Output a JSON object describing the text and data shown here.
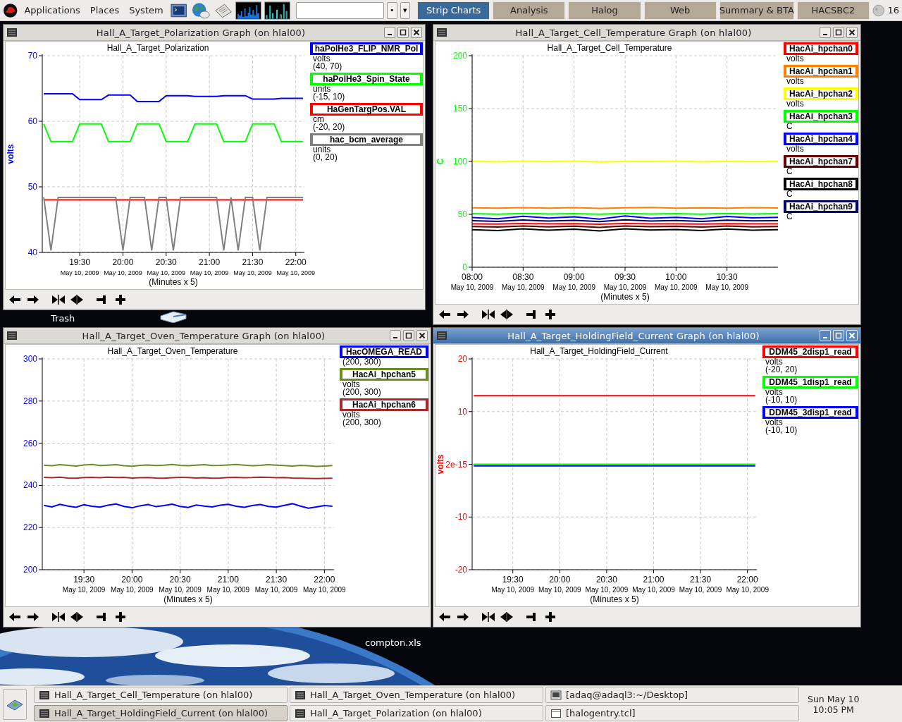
{
  "top_panel": {
    "menus": [
      "Applications",
      "Places",
      "System"
    ],
    "applet_buttons": [
      "•",
      "▾"
    ],
    "workspaces": [
      {
        "label": "Strip Charts",
        "selected": true
      },
      {
        "label": "Analysis",
        "selected": false
      },
      {
        "label": "Halog",
        "selected": false
      },
      {
        "label": "Web",
        "selected": false
      },
      {
        "label": "Summary & BTA",
        "selected": false
      },
      {
        "label": "HACSBC2",
        "selected": false
      }
    ],
    "temperature": "16"
  },
  "windows": [
    {
      "title": "Hall_A_Target_Polarization Graph (on hlal00)",
      "active": false,
      "chart_data": {
        "type": "line",
        "grid": true,
        "title": "Hall_A_Target_Polarization",
        "xlabel": "(Minutes x 5)",
        "ylabel": "volts",
        "ylim": [
          40,
          70
        ],
        "yticks": [
          40,
          50,
          60,
          70
        ],
        "categories": [
          null,
          null,
          null,
          null,
          null,
          "19:30",
          null,
          null,
          null,
          null,
          null,
          "20:00",
          null,
          null,
          null,
          null,
          null,
          "20:30",
          null,
          null,
          null,
          null,
          null,
          "21:00",
          null,
          null,
          null,
          null,
          null,
          "21:30",
          null,
          null,
          null,
          null,
          null,
          "22:00",
          null
        ],
        "series": [
          {
            "name": "haPolHe3_FLIP_NMR_Pol",
            "color": "#0000ff",
            "values": [
              64.2,
              64.2,
              64.2,
              64.2,
              64.2,
              63.3,
              63.3,
              63.3,
              63.3,
              64.0,
              64.0,
              64.0,
              64.0,
              63.0,
              63.0,
              63.0,
              63.0,
              63.9,
              63.9,
              63.9,
              63.9,
              63.8,
              63.8,
              63.8,
              63.8,
              63.9,
              63.9,
              63.9,
              63.9,
              63.4,
              63.4,
              63.4,
              63.4,
              63.5,
              63.5,
              63.5,
              63.5
            ]
          },
          {
            "name": "haPolHe3_Spin_State",
            "color": "#00ff00",
            "values": [
              59.6,
              56.9,
              56.9,
              56.9,
              56.9,
              59.6,
              59.6,
              59.6,
              59.6,
              56.9,
              56.9,
              56.9,
              56.9,
              59.6,
              59.6,
              59.6,
              59.6,
              56.9,
              56.9,
              56.9,
              56.9,
              59.6,
              59.6,
              59.6,
              59.6,
              56.9,
              56.9,
              56.9,
              56.9,
              59.6,
              59.6,
              59.6,
              59.6,
              56.9,
              56.9,
              56.9,
              56.9
            ]
          },
          {
            "name": "HaGenTargPos.VAL",
            "color": "#ff0000",
            "values": [
              48.0,
              48.0,
              48.0,
              48.0,
              48.0,
              48.0,
              48.0,
              48.0,
              48.0,
              48.0,
              48.0,
              48.0,
              48.0,
              48.0,
              48.0,
              48.0,
              48.0,
              48.0,
              48.0,
              48.0,
              48.0,
              48.0,
              48.0,
              48.0,
              48.0,
              48.0,
              48.0,
              48.0,
              48.0,
              48.0,
              48.0,
              48.0,
              48.0,
              48.0,
              48.0,
              48.0,
              48.0
            ]
          },
          {
            "name": "hac_bcm_average",
            "color": "#808080",
            "values": [
              48.4,
              40.3,
              48.4,
              48.4,
              48.4,
              48.4,
              48.4,
              48.4,
              48.4,
              48.4,
              48.4,
              40.3,
              48.4,
              48.4,
              48.4,
              40.3,
              48.4,
              48.4,
              40.3,
              48.4,
              48.4,
              48.4,
              48.4,
              48.4,
              48.4,
              40.3,
              48.4,
              40.3,
              48.4,
              48.4,
              40.3,
              48.4,
              48.4,
              48.4,
              48.4,
              48.4,
              48.4
            ]
          }
        ]
      },
      "date_labels": [
        "May 10, 2009",
        "May 10, 2009",
        "May 10, 2009",
        "May 10, 2009",
        "May 10, 2009",
        "May 10, 2009"
      ],
      "legend": [
        {
          "unit": "volts",
          "range": "(40, 70)"
        },
        {
          "unit": "units",
          "range": "(-15, 10)"
        },
        {
          "unit": "cm",
          "range": "(-20, 20)"
        },
        {
          "unit": "units",
          "range": "(0, 20)"
        }
      ]
    },
    {
      "title": "Hall_A_Target_Cell_Temperature Graph (on hlal00)",
      "active": false,
      "chart_data": {
        "type": "line",
        "grid": true,
        "title": "Hall_A_Target_Cell_Temperature",
        "xlabel": "(Minutes x 5)",
        "ylabel": "C",
        "ylim": [
          0,
          200
        ],
        "yticks": [
          0,
          50,
          100,
          150,
          200
        ],
        "categories": [
          "08:00",
          null,
          "08:30",
          null,
          "09:00",
          null,
          "09:30",
          null,
          "10:00",
          null,
          "10:30",
          null,
          null
        ],
        "series": [
          {
            "name": "HacAi_hpchan0",
            "color": "#ff0000",
            "values": [
              41.0,
              40.8,
              41.3,
              40.9,
              41.2,
              40.7,
              41.3,
              41.0,
              41.1,
              40.8,
              41.2,
              40.9,
              41.0
            ]
          },
          {
            "name": "HacAi_hpchan1",
            "color": "#ff8000",
            "values": [
              56.2,
              55.8,
              56.4,
              55.9,
              56.3,
              55.7,
              56.1,
              56.5,
              55.9,
              56.2,
              55.8,
              56.3,
              56.0
            ]
          },
          {
            "name": "HacAi_hpchan2",
            "color": "#ffff00",
            "values": [
              100.2,
              99.6,
              100.4,
              99.8,
              100.3,
              99.5,
              100.1,
              99.9,
              100.4,
              99.7,
              100.2,
              99.8,
              100.1
            ]
          },
          {
            "name": "HacAi_hpchan3",
            "color": "#00ff00",
            "values": [
              50.6,
              50.2,
              50.9,
              50.4,
              50.7,
              50.1,
              50.8,
              50.3,
              50.6,
              50.2,
              50.9,
              50.4,
              50.7
            ]
          },
          {
            "name": "HacAi_hpchan4",
            "color": "#0000ff",
            "values": [
              47.0,
              45.8,
              48.2,
              46.5,
              47.6,
              45.5,
              48.5,
              46.3,
              47.2,
              45.9,
              48.0,
              46.6,
              47.1
            ]
          },
          {
            "name": "HacAi_hpchan7",
            "color": "#660000",
            "values": [
              38.5,
              37.9,
              39.0,
              38.2,
              38.8,
              37.7,
              39.1,
              38.3,
              38.6,
              38.0,
              38.9,
              38.2,
              38.5
            ]
          },
          {
            "name": "HacAi_hpchan8",
            "color": "#000000",
            "values": [
              35.5,
              34.6,
              36.3,
              35.0,
              35.9,
              34.3,
              36.4,
              35.2,
              35.6,
              34.7,
              36.2,
              35.1,
              35.5
            ]
          },
          {
            "name": "HacAi_hpchan9",
            "color": "#000066",
            "values": [
              44.0,
              43.3,
              44.6,
              43.6,
              44.4,
              43.2,
              44.8,
              43.7,
              44.2,
              43.4,
              44.5,
              43.8,
              44.0
            ]
          }
        ]
      },
      "date_labels": [
        "May 10, 2009",
        "May 10, 2009",
        "May 10, 2009",
        "May 10, 2009",
        "May 10, 2009",
        "May 10, 2009"
      ],
      "legend": [
        {
          "unit": "volts"
        },
        {
          "unit": "volts"
        },
        {
          "unit": "volts"
        },
        {
          "unit": "C"
        },
        {
          "unit": "volts"
        },
        {
          "unit": "C"
        },
        {
          "unit": "C"
        },
        {
          "unit": "C"
        }
      ]
    },
    {
      "title": "Hall_A_Target_Oven_Temperature Graph (on hlal00)",
      "active": false,
      "chart_data": {
        "type": "line",
        "grid": true,
        "title": "Hall_A_Target_Oven_Temperature",
        "xlabel": "(Minutes x 5)",
        "ylim": [
          200,
          300
        ],
        "yticks": [
          200,
          220,
          240,
          260,
          280,
          300
        ],
        "categories": [
          null,
          null,
          null,
          null,
          null,
          "19:30",
          null,
          null,
          null,
          null,
          null,
          "20:00",
          null,
          null,
          null,
          null,
          null,
          "20:30",
          null,
          null,
          null,
          null,
          null,
          "21:00",
          null,
          null,
          null,
          null,
          null,
          "21:30",
          null,
          null,
          null,
          null,
          null,
          "22:00",
          null
        ],
        "series": [
          {
            "name": "HacOMEGA_READ",
            "color": "#0000ff",
            "values": [
              230.5,
              229.8,
              231.0,
              230.2,
              229.6,
              230.8,
              230.1,
              229.7,
              230.6,
              231.2,
              230.0,
              229.4,
              230.3,
              230.9,
              229.9,
              230.4,
              231.1,
              230.0,
              229.5,
              230.7,
              230.2,
              229.8,
              230.6,
              231.0,
              230.1,
              229.6,
              230.4,
              230.9,
              230.0,
              229.7,
              230.5,
              231.3,
              230.2,
              229.2,
              229.8,
              230.4,
              230.1
            ]
          },
          {
            "name": "HacAi_hpchan5",
            "color": "#6b8e23",
            "values": [
              249.6,
              249.3,
              249.8,
              249.5,
              249.2,
              249.7,
              249.9,
              249.4,
              249.6,
              249.8,
              249.3,
              249.1,
              249.5,
              249.7,
              249.4,
              249.6,
              249.9,
              249.5,
              249.3,
              249.6,
              249.8,
              249.4,
              249.5,
              249.7,
              249.9,
              249.6,
              249.3,
              249.5,
              249.8,
              249.6,
              249.4,
              249.2,
              249.5,
              249.3,
              249.0,
              249.2,
              249.4
            ]
          },
          {
            "name": "HacAi_hpchan6",
            "color": "#a52a2a",
            "values": [
              243.8,
              243.6,
              243.9,
              243.5,
              243.4,
              243.7,
              243.8,
              243.6,
              243.9,
              243.7,
              243.8,
              243.5,
              243.6,
              243.7,
              243.5,
              243.4,
              243.6,
              243.8,
              243.7,
              243.5,
              243.6,
              243.4,
              243.5,
              243.7,
              243.8,
              243.6,
              243.7,
              243.9,
              243.8,
              243.6,
              243.7,
              243.5,
              243.4,
              243.3,
              243.2,
              243.3,
              243.4
            ]
          }
        ]
      },
      "date_labels": [
        "May 10, 2009",
        "May 10, 2009",
        "May 10, 2009",
        "May 10, 2009",
        "May 10, 2009",
        "May 10, 2009"
      ],
      "legend": [
        {
          "range": "(200, 300)"
        },
        {
          "unit": "volts",
          "range": "(200, 300)"
        },
        {
          "unit": "volts",
          "range": "(200, 300)"
        }
      ]
    },
    {
      "title": "Hall_A_Target_HoldingField_Current Graph (on hlal00)",
      "active": true,
      "chart_data": {
        "type": "line",
        "grid": true,
        "title": "Hall_A_Target_HoldingField_Current",
        "xlabel": "(Minutes x 5)",
        "ylabel": "volts",
        "ylim": [
          -20,
          20
        ],
        "yticks": [
          -20,
          -10,
          {
            "value": 0,
            "label": "2e-15"
          },
          10,
          20
        ],
        "categories": [
          null,
          null,
          null,
          null,
          null,
          "19:30",
          null,
          null,
          null,
          null,
          null,
          "20:00",
          null,
          null,
          null,
          null,
          null,
          "20:30",
          null,
          null,
          null,
          null,
          null,
          "21:00",
          null,
          null,
          null,
          null,
          null,
          "21:30",
          null,
          null,
          null,
          null,
          null,
          "22:00",
          null
        ],
        "series": [
          {
            "name": "DDM45_2disp1_read",
            "color": "#ff0000",
            "values": [
              13,
              13,
              13,
              13,
              13,
              13,
              13,
              13,
              13,
              13,
              13,
              13,
              13,
              13,
              13,
              13,
              13,
              13,
              13,
              13,
              13,
              13,
              13,
              13,
              13,
              13,
              13,
              13,
              13,
              13,
              13,
              13,
              13,
              13,
              13,
              13,
              13
            ]
          },
          {
            "name": "DDM45_1disp1_read",
            "color": "#00ff00",
            "values": [
              0,
              0,
              0,
              0,
              0,
              0,
              0,
              0,
              0,
              0,
              0,
              0,
              0,
              0,
              0,
              0,
              0,
              0,
              0,
              0,
              0,
              0,
              0,
              0,
              0,
              0,
              0,
              0,
              0,
              0,
              0,
              0,
              0,
              0,
              0,
              0,
              0
            ]
          },
          {
            "name": "DDM45_3disp1_read",
            "color": "#0000ff",
            "values": [
              -0.3,
              -0.3,
              -0.3,
              -0.3,
              -0.3,
              -0.3,
              -0.3,
              -0.3,
              -0.3,
              -0.3,
              -0.3,
              -0.3,
              -0.3,
              -0.3,
              -0.3,
              -0.3,
              -0.3,
              -0.3,
              -0.3,
              -0.3,
              -0.3,
              -0.3,
              -0.3,
              -0.3,
              -0.3,
              -0.3,
              -0.3,
              -0.3,
              -0.3,
              -0.3,
              -0.3,
              -0.3,
              -0.3,
              -0.3,
              -0.3,
              -0.3,
              -0.3
            ]
          }
        ]
      },
      "date_labels": [
        "May 10, 2009",
        "May 10, 2009",
        "May 10, 2009",
        "May 10, 2009",
        "May 10, 2009",
        "May 10, 2009"
      ],
      "legend": [
        {
          "unit": "volts",
          "range": "(-20, 20)"
        },
        {
          "unit": "volts",
          "range": "(-10, 10)"
        },
        {
          "unit": "volts",
          "range": "(-10, 10)"
        }
      ]
    }
  ],
  "desktop_icons": [
    {
      "label": "Trash"
    },
    {
      "label": "compton.xls"
    }
  ],
  "taskbar": {
    "tasks": [
      {
        "label": "Hall_A_Target_Cell_Temperature (on hlal00)",
        "kind": "chart",
        "selected": false
      },
      {
        "label": "Hall_A_Target_Oven_Temperature (on hlal00)",
        "kind": "chart",
        "selected": false
      },
      {
        "label": "[adaq@adaql3:~/Desktop]",
        "kind": "terminal",
        "selected": false
      },
      {
        "label": "Hall_A_Target_HoldingField_Current (on hlal00)",
        "kind": "chart",
        "selected": true
      },
      {
        "label": "Hall_A_Target_Polarization (on hlal00)",
        "kind": "chart",
        "selected": false
      },
      {
        "label": "[halogentry.tcl]",
        "kind": "window",
        "selected": false
      }
    ],
    "clock": {
      "date": "Sun May 10",
      "time": "10:05 PM"
    }
  }
}
